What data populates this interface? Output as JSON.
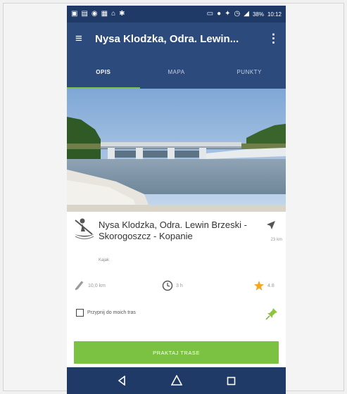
{
  "status_bar": {
    "battery": "38%",
    "time": "10:12"
  },
  "app_bar": {
    "title": "Nysa Klodzka, Odra. Lewin..."
  },
  "tabs": [
    {
      "label": "OPIS",
      "active": true
    },
    {
      "label": "MAPA",
      "active": false
    },
    {
      "label": "PUNKTY",
      "active": false
    }
  ],
  "route": {
    "title": "Nysa Klodzka, Odra. Lewin Brzeski - Skorogoszcz - Kopanie",
    "category": "Kajak",
    "distance_to": "23 km",
    "length": "10,0 km",
    "duration": "3 h",
    "rating": "4.8"
  },
  "save_option": {
    "label": "Przypnij do moich tras"
  },
  "cta": {
    "label": "PRAKTAJ TRASE"
  },
  "colors": {
    "primary": "#2d4a7c",
    "status": "#1f3a66",
    "accent": "#7cc242",
    "star": "#f5a623"
  },
  "icons": {
    "menu": "menu-icon",
    "more": "more-vert-icon",
    "navigate": "navigation-arrow-icon",
    "distance": "ruler-icon",
    "clock": "clock-icon",
    "star": "star-icon",
    "pin": "pin-icon"
  }
}
